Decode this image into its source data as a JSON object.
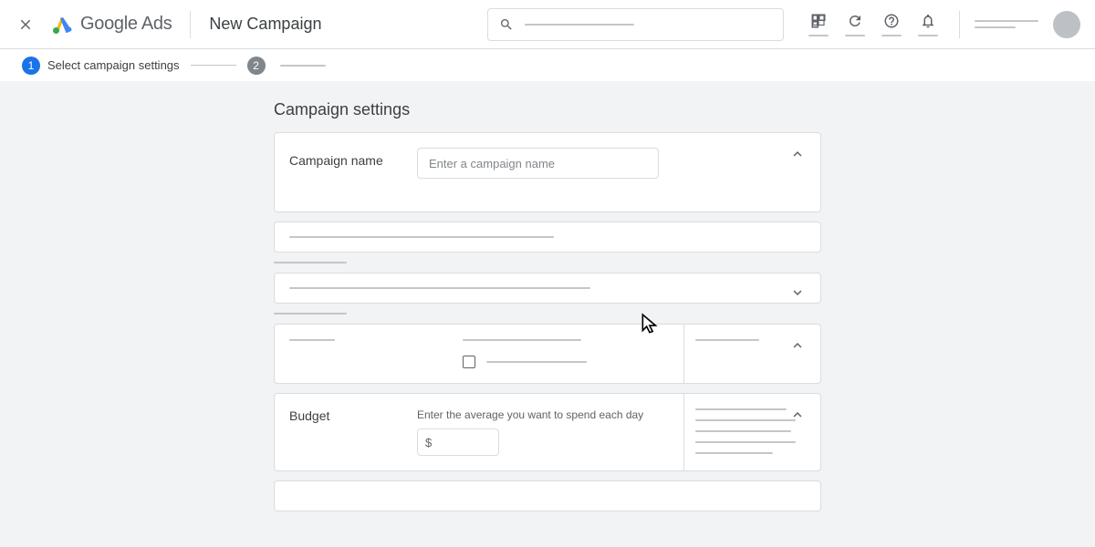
{
  "header": {
    "brand_google": "Google",
    "brand_ads": " Ads",
    "page_title": "New Campaign"
  },
  "stepper": {
    "step1_num": "1",
    "step1_label": "Select campaign settings",
    "step2_num": "2"
  },
  "main": {
    "section_title": "Campaign settings",
    "campaign_name": {
      "label": "Campaign name",
      "placeholder": "Enter a campaign name"
    },
    "budget": {
      "label": "Budget",
      "helper": "Enter the average you want to spend each day",
      "currency": "$"
    }
  }
}
